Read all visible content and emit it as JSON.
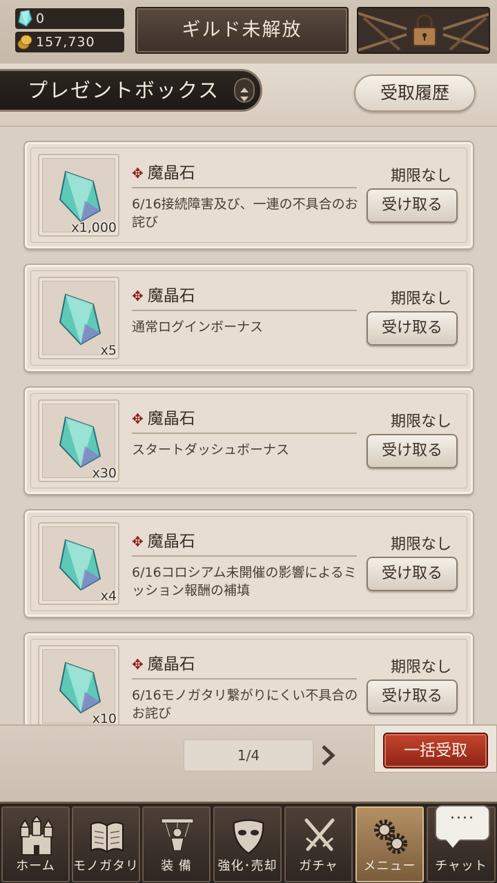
{
  "header": {
    "gems": "0",
    "coins": "157,730",
    "guild_label": "ギルド未解放",
    "locked_icon": "padlock-chains-icon"
  },
  "title": {
    "label": "プレゼントボックス",
    "history_button": "受取履歴"
  },
  "items": [
    {
      "name": "魔晶石",
      "quantity": "x1,000",
      "description": "6/16接続障害及び、一連の不具合のお詫び",
      "expiry": "期限なし",
      "button": "受け取る"
    },
    {
      "name": "魔晶石",
      "quantity": "x5",
      "description": "通常ログインボーナス",
      "expiry": "期限なし",
      "button": "受け取る"
    },
    {
      "name": "魔晶石",
      "quantity": "x30",
      "description": "スタートダッシュボーナス",
      "expiry": "期限なし",
      "button": "受け取る"
    },
    {
      "name": "魔晶石",
      "quantity": "x4",
      "description": "6/16コロシアム未開催の影響によるミッション報酬の補填",
      "expiry": "期限なし",
      "button": "受け取る"
    },
    {
      "name": "魔晶石",
      "quantity": "x10",
      "description": "6/16モノガタリ繋がりにくい不具合のお詫び",
      "expiry": "期限なし",
      "button": "受け取る"
    }
  ],
  "pagination": {
    "page": "1/4",
    "bulk_button": "一括受取"
  },
  "nav": [
    {
      "label": "ホーム",
      "icon": "castle-icon",
      "active": false
    },
    {
      "label": "モノガタリ",
      "icon": "book-icon",
      "active": false
    },
    {
      "label": "装 備",
      "icon": "puppet-icon",
      "active": false
    },
    {
      "label": "強化･売却",
      "icon": "mask-icon",
      "active": false
    },
    {
      "label": "ガチャ",
      "icon": "crossed-swords-icon",
      "active": false
    },
    {
      "label": "メニュー",
      "icon": "gears-icon",
      "active": true
    },
    {
      "label": "チャット",
      "icon": "chat-bubble-icon",
      "active": false
    }
  ],
  "chat_dots": "····",
  "colors": {
    "accent_red": "#8f2317",
    "active_nav": "#b49063"
  }
}
